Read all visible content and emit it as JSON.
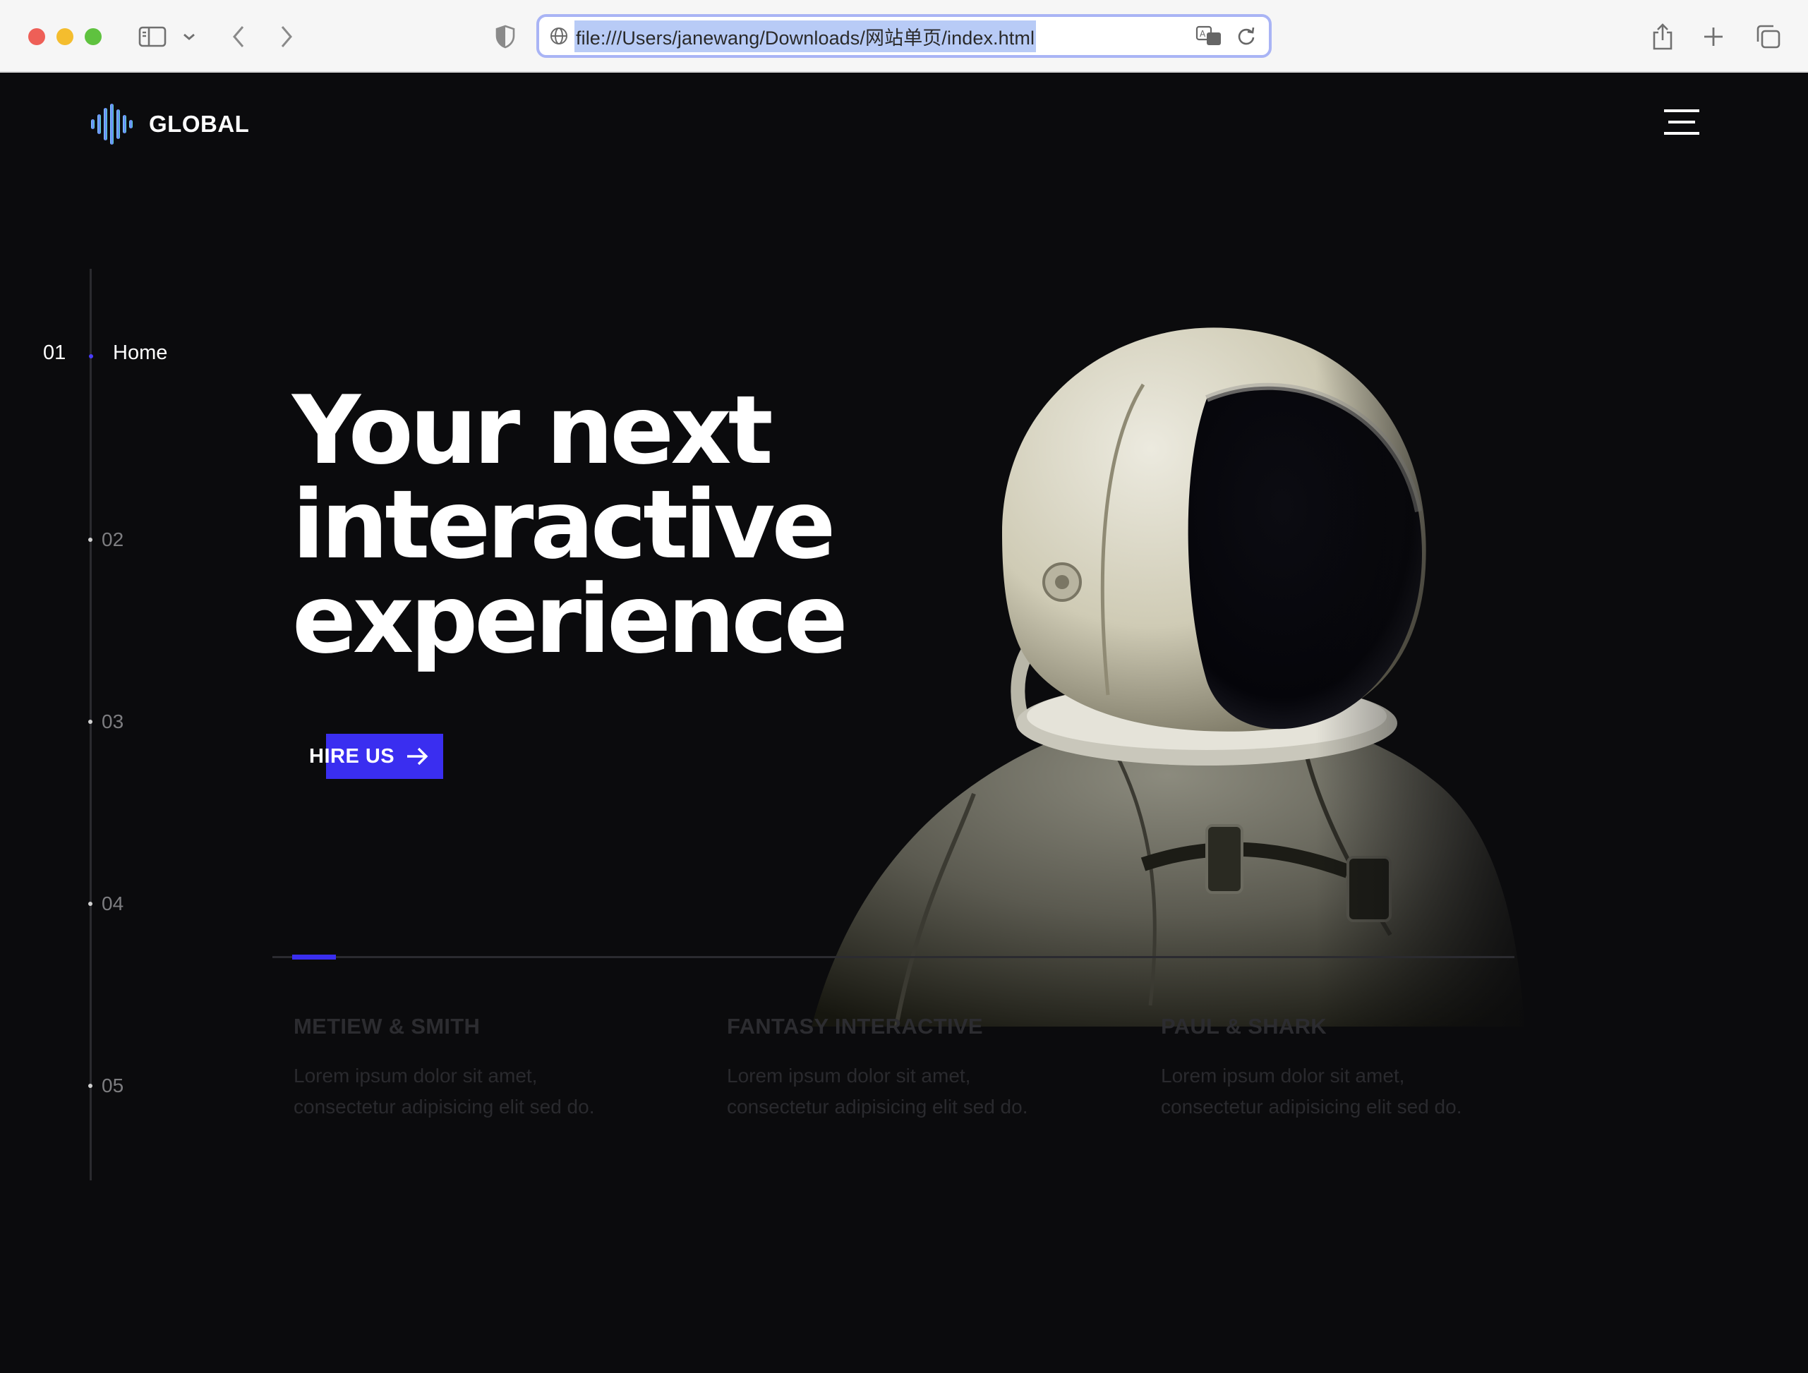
{
  "browser": {
    "url": "file:///Users/janewang/Downloads/网站单页/index.html"
  },
  "brand": {
    "name": "GLOBAL"
  },
  "side_nav": {
    "active": {
      "number": "01",
      "label": "Home"
    },
    "items": [
      {
        "number": "02"
      },
      {
        "number": "03"
      },
      {
        "number": "04"
      },
      {
        "number": "05"
      }
    ]
  },
  "hero": {
    "title_lines": [
      "Your next",
      "interactive",
      "experience"
    ],
    "cta_label": "HIRE US"
  },
  "clients": [
    {
      "name": "METIEW & SMITH",
      "line1": "Lorem ipsum dolor sit amet,",
      "line2": "consectetur adipisicing elit sed do."
    },
    {
      "name": "FANTASY INTERACTIVE",
      "line1": "Lorem ipsum dolor sit amet,",
      "line2": "consectetur adipisicing elit sed do."
    },
    {
      "name": "PAUL & SHARK",
      "line1": "Lorem ipsum dolor sit amet,",
      "line2": "consectetur adipisicing elit sed do."
    }
  ],
  "colors": {
    "accent": "#3a2ef0",
    "background": "#0b0b0d",
    "text": "#ffffff"
  },
  "icons": [
    "sidebar-icon",
    "chevron-down-icon",
    "back-icon",
    "forward-icon",
    "shield-icon",
    "globe-icon",
    "translate-icon",
    "reload-icon",
    "share-icon",
    "new-tab-icon",
    "tabs-overview-icon",
    "logo-waveform-icon",
    "hamburger-menu-icon",
    "arrow-right-icon"
  ]
}
